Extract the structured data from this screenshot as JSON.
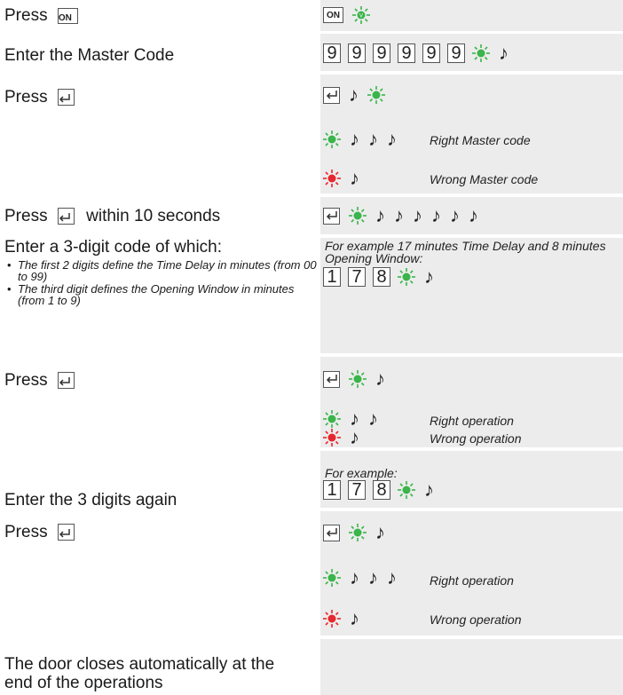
{
  "left": {
    "press_on": "Press",
    "enter_master": "Enter the Master Code",
    "press_enter_1": "Press",
    "press_within_prefix": "Press",
    "press_within_suffix": "within 10 seconds",
    "enter_3digit": "Enter a 3-digit code of which:",
    "bullet_1": "The first 2 digits define the Time Delay in minutes (from 00 to 99)",
    "bullet_2": "The third digit defines the Opening Window in minutes (from 1 to 9)",
    "press_enter_2": "Press",
    "enter_again": "Enter the 3 digits again",
    "press_enter_3": "Press",
    "door_closes_1": "The door closes automatically at the",
    "door_closes_2": "end of the operations"
  },
  "keys": {
    "on_label": "ON",
    "master_digits": [
      "9",
      "9",
      "9",
      "9",
      "9",
      "9"
    ],
    "example_digits": [
      "1",
      "7",
      "8"
    ]
  },
  "right": {
    "right_master": "Right Master code",
    "wrong_master": "Wrong Master code",
    "example_1_line1": "For example 17 minutes Time Delay and 8 minutes",
    "example_1_line2": "Opening Window:",
    "right_op_1": "Right operation",
    "wrong_op_1": "Wrong operation",
    "example_2": "For example:",
    "right_op_2": "Right operation",
    "wrong_op_2": "Wrong operation"
  },
  "icons": {
    "enter_key": "enter-key-icon",
    "green_led": "green-led-icon",
    "red_led": "red-led-icon",
    "beep": "beep-icon"
  },
  "colors": {
    "panel_gray": "#ececec",
    "green_led": "#39b54a",
    "red_led": "#e8262d"
  }
}
